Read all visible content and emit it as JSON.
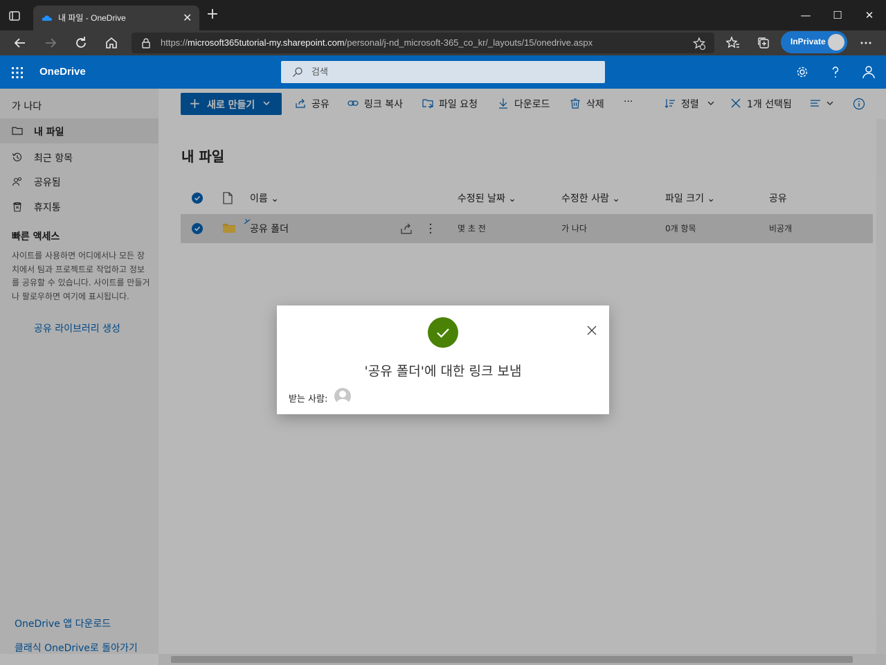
{
  "browser": {
    "tab_title": "내 파일 - OneDrive",
    "url_scheme": "https://",
    "url_host": "microsoft365tutorial-my.sharepoint.com",
    "url_path": "/personal/j-nd_microsoft-365_co_kr/_layouts/15/onedrive.aspx",
    "inprivate_label": "InPrivate"
  },
  "app": {
    "title": "OneDrive",
    "search_placeholder": "검색"
  },
  "sidebar": {
    "user": "가 나다",
    "items": [
      {
        "label": "내 파일",
        "icon": "folder-icon",
        "active": true
      },
      {
        "label": "최근 항목",
        "icon": "history-icon"
      },
      {
        "label": "공유됨",
        "icon": "people-icon"
      },
      {
        "label": "휴지통",
        "icon": "trash-icon"
      }
    ],
    "quick_access_title": "빠른 액세스",
    "quick_access_desc": "사이트를 사용하면 어디에서나 모든 장치에서 팀과 프로젝트로 작업하고 정보를 공유할 수 있습니다. 사이트를 만들거나 팔로우하면 여기에 표시됩니다.",
    "create_library": "공유 라이브러리 생성",
    "download_app": "OneDrive 앱 다운로드",
    "classic": "클래식 OneDrive로 돌아가기"
  },
  "commands": {
    "new": "새로 만들기",
    "share": "공유",
    "copy_link": "링크 복사",
    "request_files": "파일 요청",
    "download": "다운로드",
    "delete": "삭제",
    "more": "···",
    "sort": "정렬",
    "selected": "1개 선택됨"
  },
  "main": {
    "title": "내 파일",
    "columns": {
      "name": "이름",
      "modified": "수정된 날짜",
      "modified_by": "수정한 사람",
      "size": "파일 크기",
      "sharing": "공유"
    },
    "rows": [
      {
        "name": "공유 폴더",
        "modified": "몇 초 전",
        "modified_by": "가 나다",
        "size": "0개 항목",
        "sharing": "비공개"
      }
    ]
  },
  "dialog": {
    "title": "'공유 폴더'에 대한 링크 보냄",
    "recipients_label": "받는 사람:"
  },
  "colors": {
    "brand": "#0364b8",
    "success": "#498205"
  }
}
